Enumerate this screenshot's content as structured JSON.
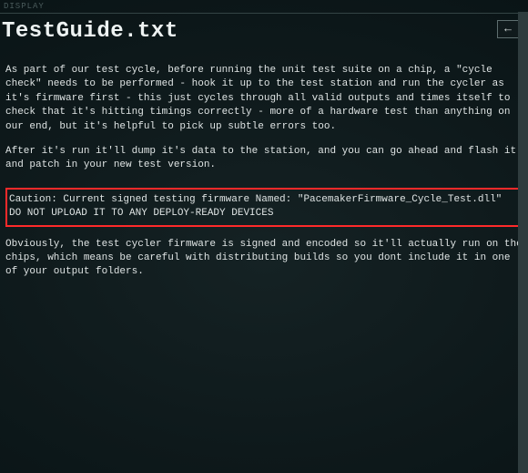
{
  "topbar_label": "DISPLAY",
  "title": "TestGuide.txt",
  "back_arrow": "←",
  "paragraphs": {
    "p1": "As part of our test cycle, before running the unit test suite on a chip, a \"cycle check\" needs to be performed - hook it up to the test station and run the cycler as it's firmware first - this just cycles through all valid outputs and times itself to check that it's hitting timings correctly - more of a hardware test than anything on our end, but it's helpful to pick up subtle errors too.",
    "p2": "After it's run it'll dump it's data to the station, and you can go ahead and flash it and patch in your new test version.",
    "p3": "Obviously, the test cycler firmware is signed and encoded so it'll actually run on the chips, which means be careful with distributing builds so you dont include it in one of your output folders."
  },
  "caution": {
    "line1": "Caution: Current signed testing firmware Named: \"PacemakerFirmware_Cycle_Test.dll\"",
    "line2": "DO NOT UPLOAD IT TO ANY DEPLOY-READY DEVICES"
  }
}
